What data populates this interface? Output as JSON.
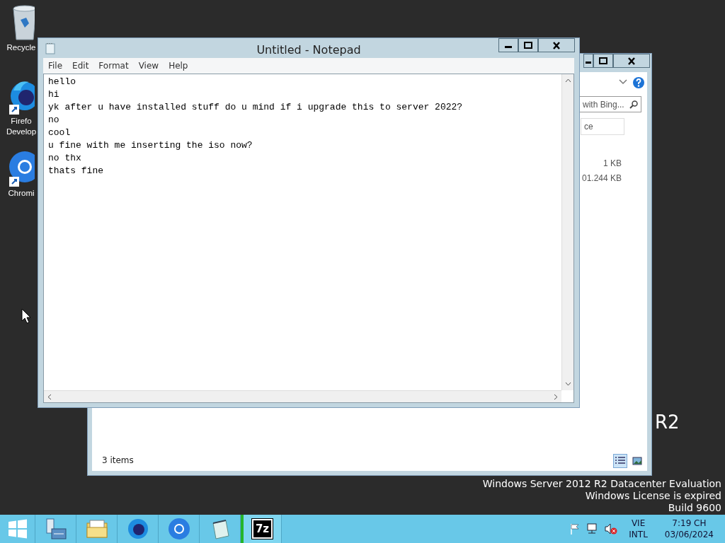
{
  "desktop_icons": [
    {
      "kind": "recycle",
      "lines": [
        "Recycle"
      ]
    },
    {
      "kind": "firefox",
      "lines": [
        "Firefo",
        "Develop"
      ]
    },
    {
      "kind": "chromium",
      "lines": [
        "Chromi"
      ]
    }
  ],
  "desktop_text": {
    "edition_tail": "R2",
    "lines": [
      "Windows Server 2012 R2 Datacenter Evaluation",
      "Windows License is expired",
      "Build 9600"
    ]
  },
  "explorer": {
    "search_placeholder": "with Bing...",
    "field_text": "ce",
    "sizes": [
      "1 KB",
      "01.244 KB"
    ],
    "status": "3 items",
    "view_buttons": [
      {
        "kind": "details",
        "selected": true
      },
      {
        "kind": "tiles",
        "selected": false
      }
    ]
  },
  "notepad": {
    "title": "Untitled - Notepad",
    "menu": [
      "File",
      "Edit",
      "Format",
      "View",
      "Help"
    ],
    "lines": [
      "hello",
      "hi",
      "yk after u have installed stuff do u mind if i upgrade this to server 2022?",
      "no",
      "cool",
      "u fine with me inserting the iso now?",
      "no thx",
      "thats fine"
    ]
  },
  "taskbar": {
    "apps": [
      {
        "kind": "server-manager",
        "active": false
      },
      {
        "kind": "file-explorer",
        "active": false
      },
      {
        "kind": "firefox",
        "active": false
      },
      {
        "kind": "chromium",
        "active": false
      },
      {
        "kind": "notepad",
        "active": false
      },
      {
        "kind": "sevenzip",
        "active": true
      }
    ],
    "tray_label": "7z",
    "language": [
      "VIE",
      "INTL"
    ],
    "time": "7:19 CH",
    "date": "03/06/2024"
  }
}
